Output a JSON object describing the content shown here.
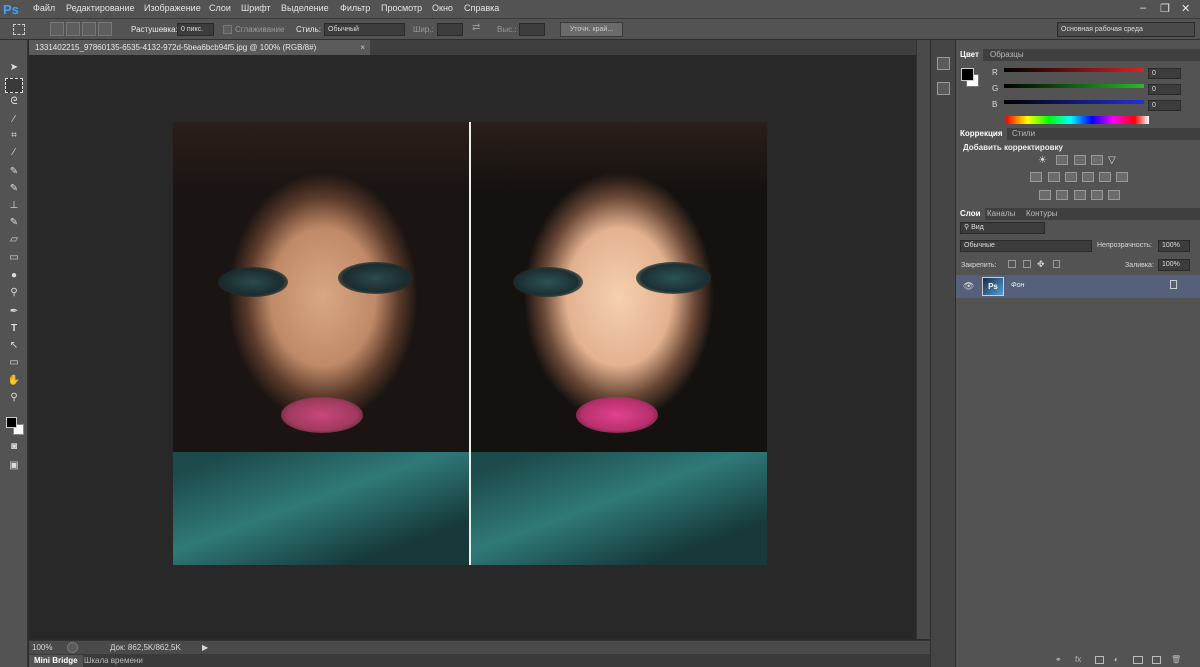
{
  "app": {
    "logo": "Ps"
  },
  "menu": [
    "Файл",
    "Редактирование",
    "Изображение",
    "Слои",
    "Шрифт",
    "Выделение",
    "Фильтр",
    "Просмотр",
    "Окно",
    "Справка"
  ],
  "options": {
    "feather_label": "Растушевка:",
    "feather_value": "0 пикс.",
    "antialias_label": "Сглаживание",
    "style_label": "Стиль:",
    "style_value": "Обычный",
    "width_label": "Шир.:",
    "height_label": "Выс.:",
    "refine_button": "Уточн. край...",
    "workspace": "Основная рабочая среда"
  },
  "document": {
    "tab_title": "1331402215_97860135-6535-4132-972d-5bea6bcb94f5.jpg @ 100% (RGB/8#)",
    "close": "×"
  },
  "status": {
    "zoom": "100%",
    "doc_info": "Док: 862,5K/862,5K"
  },
  "bottom_tabs": [
    "Mini Bridge",
    "Шкала времени"
  ],
  "color_panel": {
    "tabs": [
      "Цвет",
      "Образцы"
    ],
    "channels": [
      {
        "name": "R",
        "value": "0",
        "color": "#e02020"
      },
      {
        "name": "G",
        "value": "0",
        "color": "#20c020"
      },
      {
        "name": "B",
        "value": "0",
        "color": "#2030e0"
      }
    ]
  },
  "adjust_panel": {
    "tabs": [
      "Коррекция",
      "Стили"
    ],
    "title": "Добавить корректировку"
  },
  "layers_panel": {
    "tabs": [
      "Слои",
      "Каналы",
      "Контуры"
    ],
    "kind": "Вид",
    "blend": "Обычные",
    "opacity_label": "Непрозрачность:",
    "opacity_value": "100%",
    "lock_label": "Закрепить:",
    "fill_label": "Заливка:",
    "fill_value": "100%",
    "layer_name": "Фон"
  }
}
